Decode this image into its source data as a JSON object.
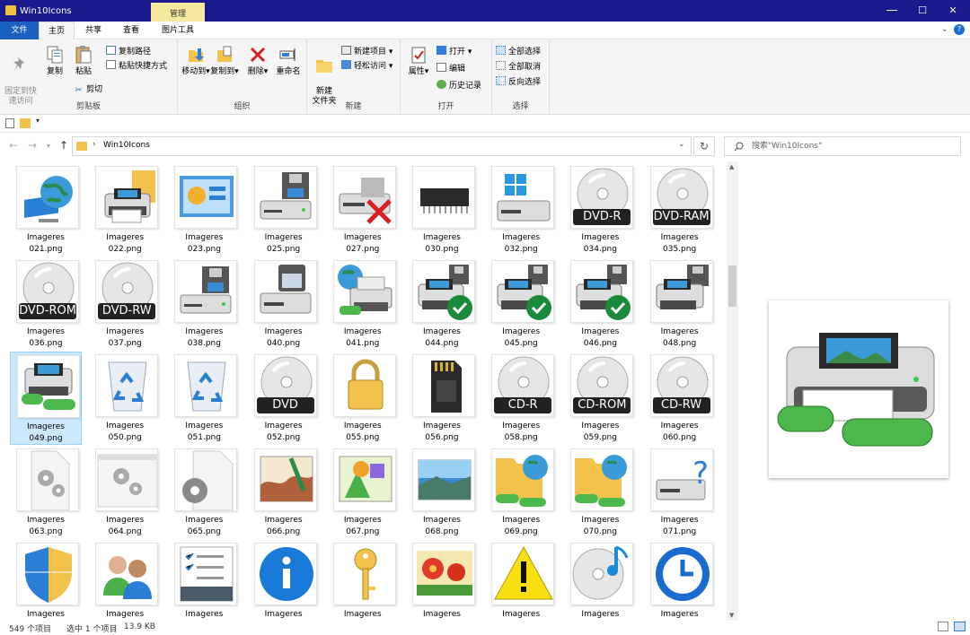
{
  "window": {
    "title": "Win10Icons",
    "context_tab": "管理",
    "min": "—",
    "max": "☐",
    "close": "✕"
  },
  "tabs": {
    "file": "文件",
    "home": "主页",
    "share": "共享",
    "view": "查看",
    "picture_tools": "图片工具"
  },
  "ribbon": {
    "pin": "固定到快\n速访问",
    "copy": "复制",
    "paste": "粘贴",
    "copy_path": "复制路径",
    "paste_shortcut": "粘贴快捷方式",
    "cut": "剪切",
    "clipboard": "剪贴板",
    "move_to": "移动到",
    "copy_to": "复制到",
    "delete": "删除",
    "rename": "重命名",
    "organize": "组织",
    "new_folder": "新建\n文件夹",
    "new_item": "新建项目",
    "easy_access": "轻松访问",
    "new": "新建",
    "properties": "属性",
    "open": "打开",
    "edit": "编辑",
    "history": "历史记录",
    "open_group": "打开",
    "select_all": "全部选择",
    "select_none": "全部取消",
    "invert": "反向选择",
    "select": "选择"
  },
  "address": {
    "path": "Win10Icons",
    "search_placeholder": "搜索\"Win10Icons\""
  },
  "items": [
    {
      "n": "021.png",
      "k": "globe"
    },
    {
      "n": "022.png",
      "k": "printer-doc"
    },
    {
      "n": "023.png",
      "k": "panel"
    },
    {
      "n": "025.png",
      "k": "drive-floppy"
    },
    {
      "n": "027.png",
      "k": "drive-x"
    },
    {
      "n": "030.png",
      "k": "chip"
    },
    {
      "n": "032.png",
      "k": "drive-win"
    },
    {
      "n": "034.png",
      "k": "disc",
      "l": "DVD-R"
    },
    {
      "n": "035.png",
      "k": "disc",
      "l": "DVD-RAM"
    },
    {
      "n": "036.png",
      "k": "disc",
      "l": "DVD-ROM"
    },
    {
      "n": "037.png",
      "k": "disc",
      "l": "DVD-RW"
    },
    {
      "n": "038.png",
      "k": "drive-floppy"
    },
    {
      "n": "040.png",
      "k": "drive-media"
    },
    {
      "n": "041.png",
      "k": "net-printer"
    },
    {
      "n": "044.png",
      "k": "printer-check"
    },
    {
      "n": "045.png",
      "k": "printer-check"
    },
    {
      "n": "046.png",
      "k": "printer-check"
    },
    {
      "n": "048.png",
      "k": "printer-floppy"
    },
    {
      "n": "049.png",
      "k": "printer-net",
      "sel": true
    },
    {
      "n": "050.png",
      "k": "recycle"
    },
    {
      "n": "051.png",
      "k": "recycle"
    },
    {
      "n": "052.png",
      "k": "disc",
      "l": "DVD"
    },
    {
      "n": "055.png",
      "k": "lock"
    },
    {
      "n": "056.png",
      "k": "sdcard"
    },
    {
      "n": "058.png",
      "k": "disc",
      "l": "CD-R"
    },
    {
      "n": "059.png",
      "k": "disc",
      "l": "CD-ROM"
    },
    {
      "n": "060.png",
      "k": "disc",
      "l": "CD-RW"
    },
    {
      "n": "063.png",
      "k": "gears"
    },
    {
      "n": "064.png",
      "k": "gears-win"
    },
    {
      "n": "065.png",
      "k": "gear-doc"
    },
    {
      "n": "066.png",
      "k": "paint"
    },
    {
      "n": "067.png",
      "k": "shapes"
    },
    {
      "n": "068.png",
      "k": "landscape"
    },
    {
      "n": "069.png",
      "k": "folder-globe"
    },
    {
      "n": "070.png",
      "k": "folder-globe"
    },
    {
      "n": "071.png",
      "k": "drive-q"
    },
    {
      "n": "",
      "k": "shield"
    },
    {
      "n": "",
      "k": "users"
    },
    {
      "n": "",
      "k": "checklist"
    },
    {
      "n": "",
      "k": "info"
    },
    {
      "n": "",
      "k": "key"
    },
    {
      "n": "",
      "k": "flowers"
    },
    {
      "n": "",
      "k": "warning"
    },
    {
      "n": "",
      "k": "disc-music"
    },
    {
      "n": "",
      "k": "clock"
    }
  ],
  "item_caption": "Imageres",
  "status": {
    "count": "549 个项目",
    "selected": "选中 1 个项目",
    "size": "13.9 KB"
  },
  "colors": {
    "titlebar": "#1a1a8c",
    "file_tab": "#1a60c0",
    "selection": "#cce8ff"
  }
}
